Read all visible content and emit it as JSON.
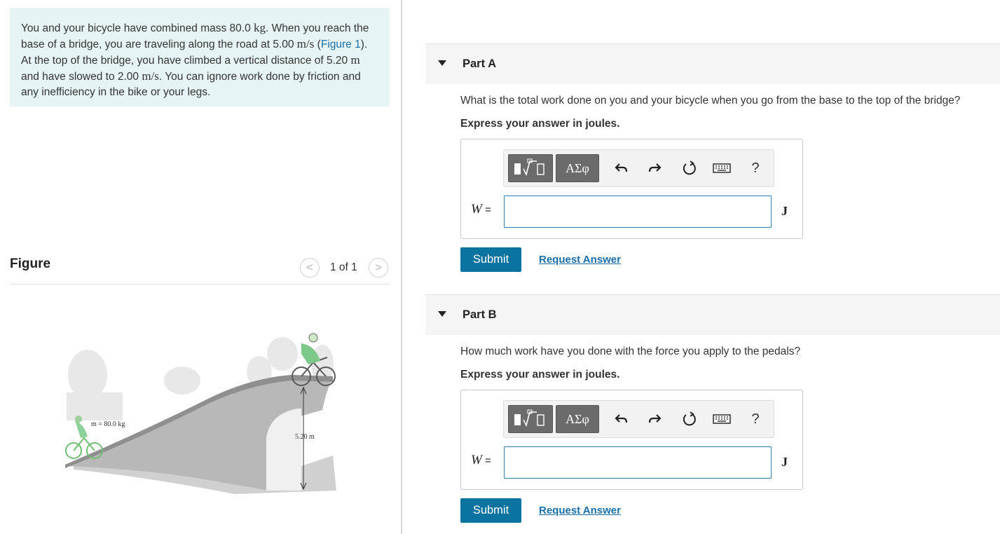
{
  "problem": {
    "text_1": "You and your bicycle have combined mass 80.0 ",
    "unit_kg": "kg",
    "text_2": ". When you reach the base of a bridge, you are traveling along the road at 5.00 ",
    "unit_ms_1": "m/s",
    "text_3": " (",
    "figure_link": "Figure 1",
    "text_4": "). At the top of the bridge, you have climbed a vertical distance of 5.20 ",
    "unit_m": "m",
    "text_5": " and have slowed to 2.00 ",
    "unit_ms_2": "m/s",
    "text_6": ". You can ignore work done by friction and any inefficiency in the bike or your legs."
  },
  "figure": {
    "heading": "Figure",
    "prev_icon": "chevron-left-icon",
    "next_icon": "chevron-right-icon",
    "prev_glyph": "<",
    "next_glyph": ">",
    "counter": "1 of 1",
    "mass_label": "m = 80.0 kg",
    "height_label": "5.20 m"
  },
  "toolbar": {
    "greek_label": "ΑΣφ",
    "help_label": "?",
    "icons": [
      "template-icon",
      "greek-letters-icon",
      "undo-icon",
      "redo-icon",
      "reset-icon",
      "keyboard-icon",
      "help-icon"
    ]
  },
  "parts": [
    {
      "title": "Part A",
      "question": "What is the total work done on you and your bicycle when you go from the base to the top of the bridge?",
      "instruction": "Express your answer in joules.",
      "variable": "W",
      "equals": " =",
      "input_value": "",
      "unit": "J",
      "submit_label": "Submit",
      "request_label": "Request Answer"
    },
    {
      "title": "Part B",
      "question": "How much work have you done with the force you apply to the pedals?",
      "instruction": "Express your answer in joules.",
      "variable": "W",
      "equals": " =",
      "input_value": "",
      "unit": "J",
      "submit_label": "Submit",
      "request_label": "Request Answer"
    }
  ],
  "colors": {
    "problem_bg": "#e6f4f5",
    "link": "#1a6fa8",
    "submit": "#0a73a0",
    "input_border": "#2d7fb3"
  }
}
